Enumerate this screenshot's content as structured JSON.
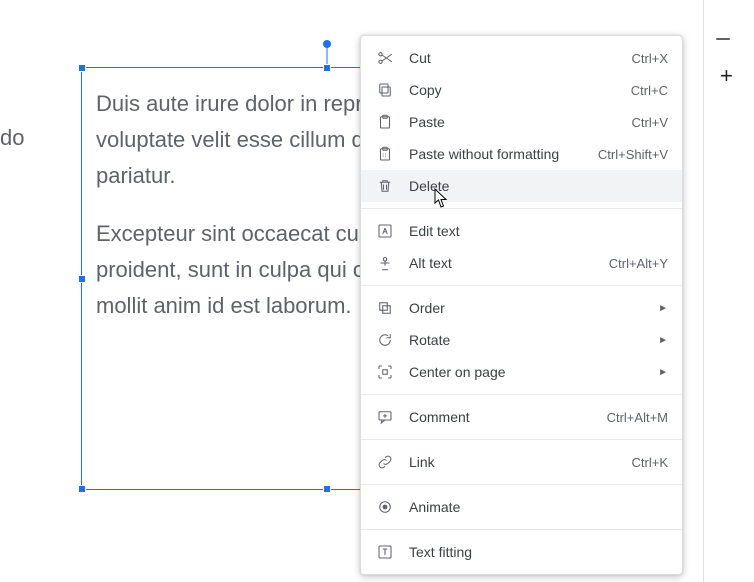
{
  "left_fragment": "do",
  "textbox": {
    "para1": "Duis aute irure dolor in reprehenderit in voluptate velit esse cillum dolore eu fugiat nulla pariatur.",
    "para2": "Excepteur sint occaecat cupidatat non proident, sunt in culpa qui officia deserunt mollit anim id est laborum."
  },
  "toolbar": {
    "add_label": "+"
  },
  "menu": {
    "cut": {
      "label": "Cut",
      "shortcut": "Ctrl+X"
    },
    "copy": {
      "label": "Copy",
      "shortcut": "Ctrl+C"
    },
    "paste": {
      "label": "Paste",
      "shortcut": "Ctrl+V"
    },
    "paste_nf": {
      "label": "Paste without formatting",
      "shortcut": "Ctrl+Shift+V"
    },
    "delete": {
      "label": "Delete",
      "shortcut": ""
    },
    "edit_text": {
      "label": "Edit text",
      "shortcut": ""
    },
    "alt_text": {
      "label": "Alt text",
      "shortcut": "Ctrl+Alt+Y"
    },
    "order": {
      "label": "Order",
      "shortcut": ""
    },
    "rotate": {
      "label": "Rotate",
      "shortcut": ""
    },
    "center": {
      "label": "Center on page",
      "shortcut": ""
    },
    "comment": {
      "label": "Comment",
      "shortcut": "Ctrl+Alt+M"
    },
    "link": {
      "label": "Link",
      "shortcut": "Ctrl+K"
    },
    "animate": {
      "label": "Animate",
      "shortcut": ""
    },
    "textfit": {
      "label": "Text fitting",
      "shortcut": ""
    },
    "submenu_glyph": "►"
  },
  "colors": {
    "select": "#1a73e8",
    "text": "#3c4043",
    "muted": "#5f6368"
  }
}
